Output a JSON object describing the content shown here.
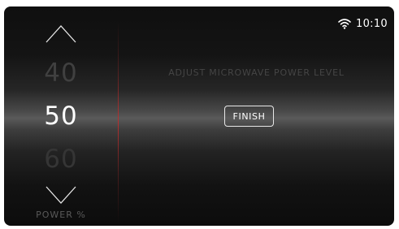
{
  "status_bar": {
    "wifi_icon": "wifi-icon",
    "time": "10:10"
  },
  "picker": {
    "up_icon": "chevron-up-icon",
    "down_icon": "chevron-down-icon",
    "previous_value": "40",
    "current_value": "50",
    "next_value": "60",
    "unit_label": "POWER %"
  },
  "main": {
    "instruction": "ADJUST MICROWAVE POWER LEVEL",
    "finish_label": "FINISH"
  },
  "colors": {
    "divider_accent": "#c0302e",
    "text_active": "#ffffff",
    "text_dim": "#454545"
  }
}
